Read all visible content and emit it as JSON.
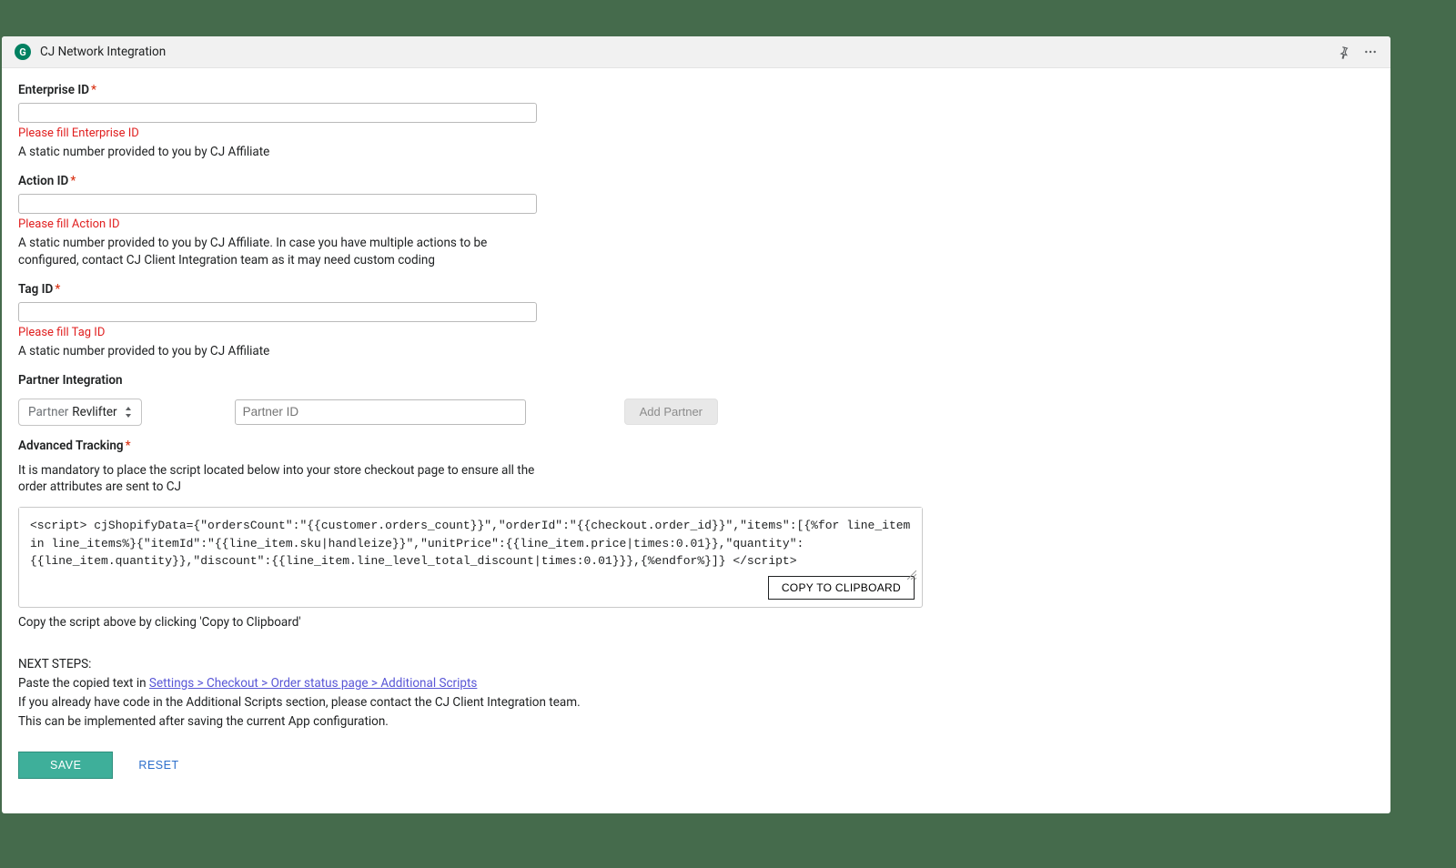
{
  "header": {
    "app_icon_letter": "G",
    "title": "CJ Network Integration"
  },
  "fields": {
    "enterprise": {
      "label": "Enterprise ID",
      "value": "",
      "error": "Please fill Enterprise ID",
      "help": "A static number provided to you by CJ Affiliate"
    },
    "action": {
      "label": "Action ID",
      "value": "",
      "error": "Please fill Action ID",
      "help": "A static number provided to you by CJ Affiliate. In case you have multiple actions to be configured, contact CJ Client Integration team as it may need custom coding"
    },
    "tag": {
      "label": "Tag ID",
      "value": "",
      "error": "Please fill Tag ID",
      "help": "A static number provided to you by CJ Affiliate"
    }
  },
  "partner": {
    "section_label": "Partner Integration",
    "prefix": "Partner",
    "selected": "Revlifter",
    "id_placeholder": "Partner ID",
    "add_button": "Add Partner"
  },
  "tracking": {
    "label": "Advanced Tracking",
    "description": "It is mandatory to place the script located below into your store checkout page to ensure all the order attributes are sent to CJ",
    "script": "<script> cjShopifyData={\"ordersCount\":\"{{customer.orders_count}}\",\"orderId\":\"{{checkout.order_id}}\",\"items\":[{%for line_item in line_items%}{\"itemId\":\"{{line_item.sku|handleize}}\",\"unitPrice\":{{line_item.price|times:0.01}},\"quantity\":{{line_item.quantity}},\"discount\":{{line_item.line_level_total_discount|times:0.01}}},{%endfor%}]} </script>",
    "copy_button": "COPY TO CLIPBOARD",
    "copy_hint": "Copy the script above by clicking 'Copy to Clipboard'"
  },
  "next_steps": {
    "heading": "NEXT STEPS:",
    "paste_prefix": "Paste the copied text in ",
    "link_text": "Settings > Checkout > Order status page > Additional Scripts",
    "line2": "If you already have code in the Additional Scripts section, please contact the CJ Client Integration team.",
    "line3": "This can be implemented after saving the current App configuration."
  },
  "actions": {
    "save": "SAVE",
    "reset": "RESET"
  }
}
